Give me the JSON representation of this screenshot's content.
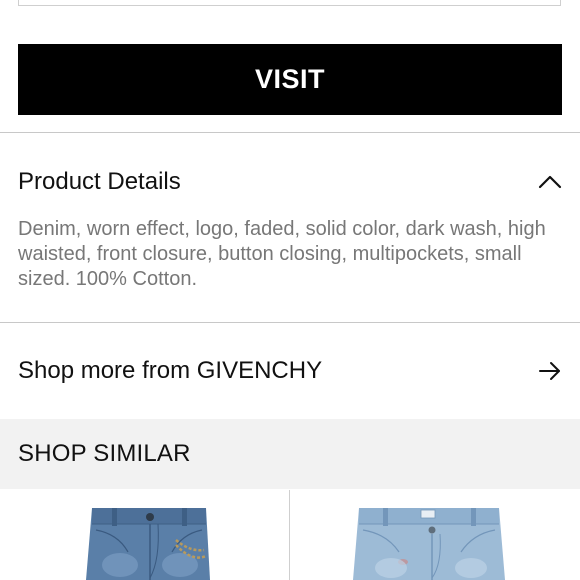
{
  "visit_button": {
    "label": "VISIT"
  },
  "product_details": {
    "title": "Product Details",
    "description": "Denim, worn effect, logo, faded, solid color, dark wash, high waisted, front closure, button closing, multipockets, small sized. 100% Cotton.",
    "toggle_icon": "chevron-up-icon"
  },
  "shop_more": {
    "label": "Shop more from GIVENCHY",
    "icon": "arrow-right-icon"
  },
  "shop_similar": {
    "title": "SHOP SIMILAR",
    "items": [
      {
        "image": "dark-wash-jeans-with-chain"
      },
      {
        "image": "light-wash-jeans"
      }
    ]
  },
  "colors": {
    "button_bg": "#000000",
    "body_text": "#777777",
    "band_bg": "#f2f2f2",
    "divider": "#c8c8c8"
  }
}
